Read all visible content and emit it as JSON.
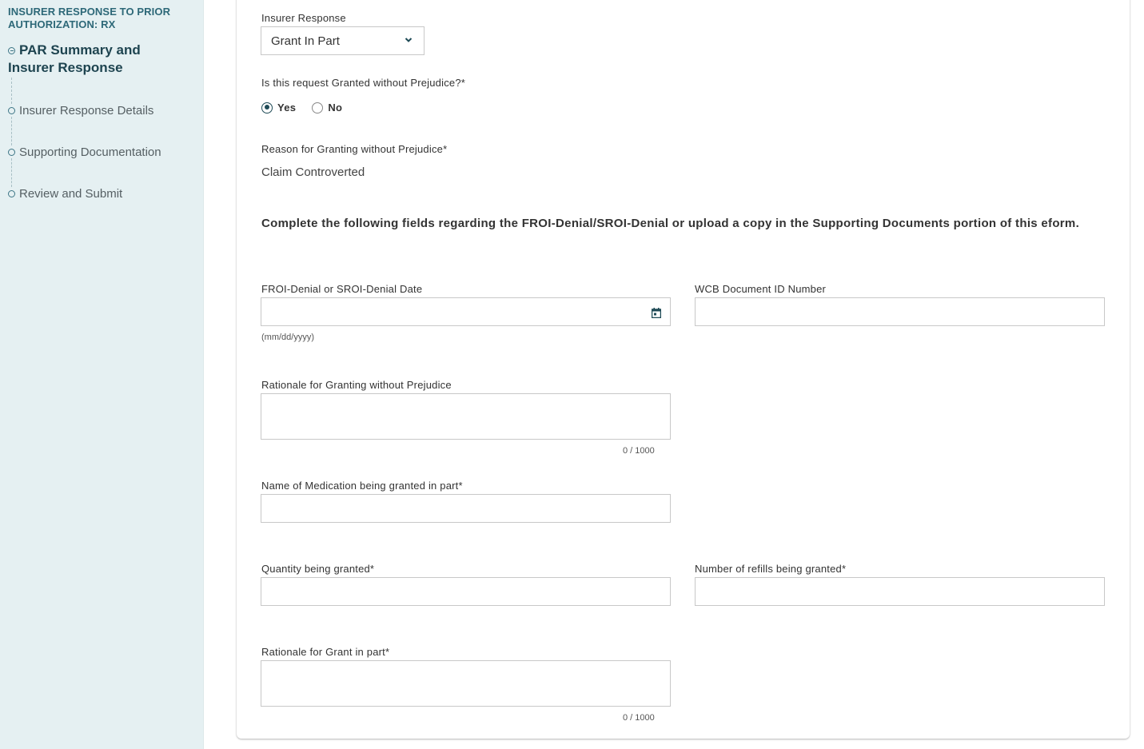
{
  "sidebar": {
    "title": "INSURER RESPONSE TO PRIOR AUTHORIZATION: RX",
    "items": [
      {
        "label": "PAR Summary and Insurer Response",
        "active": true,
        "icon": "circle-minus-icon"
      },
      {
        "label": "Insurer Response Details",
        "active": false,
        "icon": "circle-outline-icon"
      },
      {
        "label": "Supporting Documentation",
        "active": false,
        "icon": "circle-outline-icon"
      },
      {
        "label": "Review and Submit",
        "active": false,
        "icon": "circle-outline-icon"
      }
    ]
  },
  "form": {
    "insurer_response": {
      "label": "Insurer Response",
      "value": "Grant In Part",
      "icon": "chevron-down-icon"
    },
    "granted_without_prejudice": {
      "label": "Is this request Granted without Prejudice?*",
      "options": [
        {
          "label": "Yes",
          "checked": true
        },
        {
          "label": "No",
          "checked": false
        }
      ]
    },
    "reason_granting": {
      "label": "Reason for Granting without Prejudice*",
      "value": "Claim Controverted"
    },
    "instruction": "Complete the following fields regarding the FROI-Denial/SROI-Denial or upload a copy in the Supporting Documents portion of this eform.",
    "denial_date": {
      "label": "FROI-Denial or SROI-Denial Date",
      "value": "",
      "hint": "(mm/dd/yyyy)",
      "icon": "calendar-icon"
    },
    "wcb_document_id": {
      "label": "WCB Document ID Number",
      "value": ""
    },
    "rationale_without_prejudice": {
      "label": "Rationale for Granting without Prejudice",
      "value": "",
      "char_count": "0 / 1000"
    },
    "medication_name": {
      "label": "Name of Medication being granted in part*",
      "value": ""
    },
    "quantity_granted": {
      "label": "Quantity being granted*",
      "value": ""
    },
    "refills_granted": {
      "label": "Number of refills being granted*",
      "value": ""
    },
    "rationale_grant_in_part": {
      "label": "Rationale for Grant in part*",
      "value": "",
      "char_count": "0 / 1000"
    }
  },
  "colors": {
    "sidebar_bg": "#e5f0f2",
    "sidebar_title": "#2d6878",
    "accent": "#1e4a56",
    "border": "#c8c8c8"
  }
}
